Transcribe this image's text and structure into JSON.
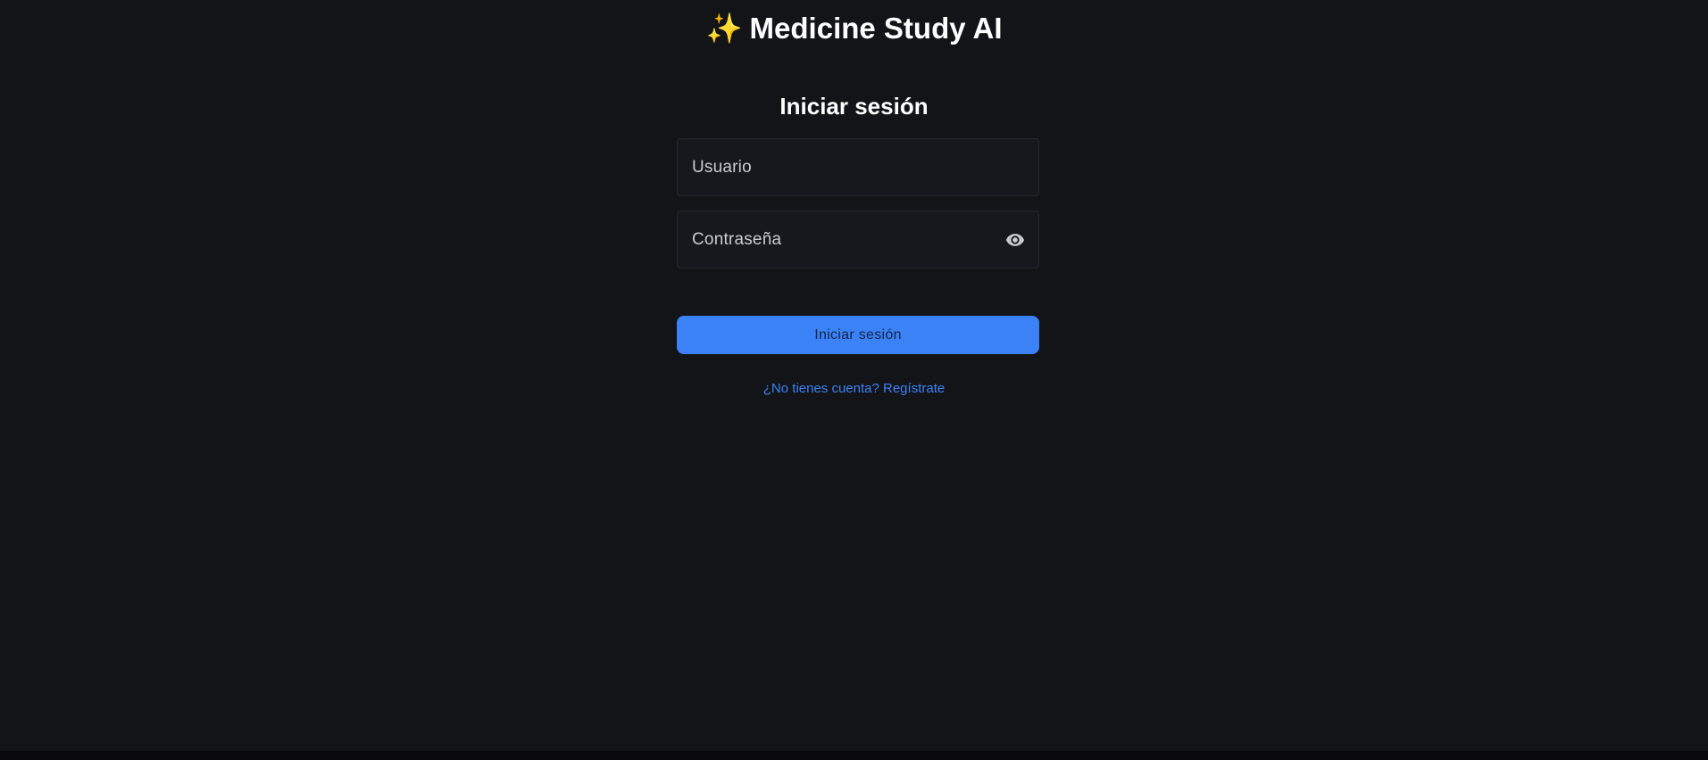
{
  "brand": {
    "icon": "sparkles-icon",
    "glyph": "✨",
    "title": "Medicine Study AI"
  },
  "login": {
    "title": "Iniciar sesión",
    "username_placeholder": "Usuario",
    "password_placeholder": "Contraseña",
    "toggle_icon": "eye-icon",
    "submit_label": "Iniciar sesión",
    "register_link": "¿No tienes cuenta? Regístrate"
  },
  "colors": {
    "background": "#131418",
    "field_background": "#17181d",
    "accent": "#3b82f6",
    "sparkle": "#f7c948"
  }
}
